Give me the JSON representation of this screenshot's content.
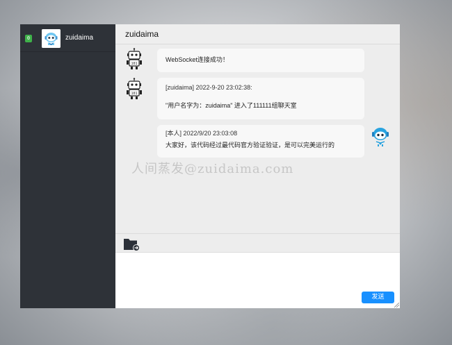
{
  "sidebar": {
    "contacts": [
      {
        "badge": "0",
        "name": "zuidaima",
        "avatar_icon": "robot-avatar-icon"
      }
    ]
  },
  "chat": {
    "title": "zuidaima",
    "messages": [
      {
        "sender": "system",
        "text": "WebSocket连接成功！"
      },
      {
        "sender": "system",
        "meta": "[zuidaima] 2022-9-20 23:02:38:",
        "text": "\"用户名字为：zuidaima\" 进入了111111组聊天室"
      },
      {
        "sender": "self",
        "meta": "[本人] 2022/9/20 23:03:08",
        "text": "大家好，该代码经过最代码官方验证验证，是可以完美运行的"
      }
    ]
  },
  "watermark": "人间蒸发@zuidaima.com",
  "toolbar": {
    "file_icon": "folder-upload-icon"
  },
  "composer": {
    "value": "",
    "send_label": "发送"
  },
  "colors": {
    "sidebar": "#2e3238",
    "accent": "#1890ff",
    "badge": "#3fb24a",
    "chat_bg": "#ededed"
  }
}
